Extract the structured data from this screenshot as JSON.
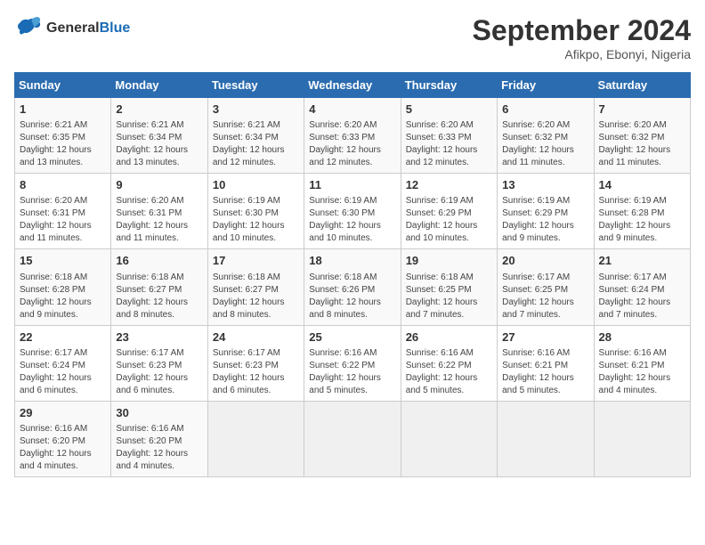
{
  "logo": {
    "line1": "General",
    "line2": "Blue"
  },
  "title": "September 2024",
  "location": "Afikpo, Ebonyi, Nigeria",
  "weekdays": [
    "Sunday",
    "Monday",
    "Tuesday",
    "Wednesday",
    "Thursday",
    "Friday",
    "Saturday"
  ],
  "days": [
    {
      "num": "",
      "info": ""
    },
    {
      "num": "",
      "info": ""
    },
    {
      "num": "",
      "info": ""
    },
    {
      "num": "",
      "info": ""
    },
    {
      "num": "",
      "info": ""
    },
    {
      "num": "",
      "info": ""
    },
    {
      "num": "1",
      "info": "Sunrise: 6:21 AM\nSunset: 6:35 PM\nDaylight: 12 hours\nand 13 minutes."
    },
    {
      "num": "2",
      "info": "Sunrise: 6:21 AM\nSunset: 6:34 PM\nDaylight: 12 hours\nand 13 minutes."
    },
    {
      "num": "3",
      "info": "Sunrise: 6:21 AM\nSunset: 6:34 PM\nDaylight: 12 hours\nand 12 minutes."
    },
    {
      "num": "4",
      "info": "Sunrise: 6:20 AM\nSunset: 6:33 PM\nDaylight: 12 hours\nand 12 minutes."
    },
    {
      "num": "5",
      "info": "Sunrise: 6:20 AM\nSunset: 6:33 PM\nDaylight: 12 hours\nand 12 minutes."
    },
    {
      "num": "6",
      "info": "Sunrise: 6:20 AM\nSunset: 6:32 PM\nDaylight: 12 hours\nand 11 minutes."
    },
    {
      "num": "7",
      "info": "Sunrise: 6:20 AM\nSunset: 6:32 PM\nDaylight: 12 hours\nand 11 minutes."
    },
    {
      "num": "8",
      "info": "Sunrise: 6:20 AM\nSunset: 6:31 PM\nDaylight: 12 hours\nand 11 minutes."
    },
    {
      "num": "9",
      "info": "Sunrise: 6:20 AM\nSunset: 6:31 PM\nDaylight: 12 hours\nand 11 minutes."
    },
    {
      "num": "10",
      "info": "Sunrise: 6:19 AM\nSunset: 6:30 PM\nDaylight: 12 hours\nand 10 minutes."
    },
    {
      "num": "11",
      "info": "Sunrise: 6:19 AM\nSunset: 6:30 PM\nDaylight: 12 hours\nand 10 minutes."
    },
    {
      "num": "12",
      "info": "Sunrise: 6:19 AM\nSunset: 6:29 PM\nDaylight: 12 hours\nand 10 minutes."
    },
    {
      "num": "13",
      "info": "Sunrise: 6:19 AM\nSunset: 6:29 PM\nDaylight: 12 hours\nand 9 minutes."
    },
    {
      "num": "14",
      "info": "Sunrise: 6:19 AM\nSunset: 6:28 PM\nDaylight: 12 hours\nand 9 minutes."
    },
    {
      "num": "15",
      "info": "Sunrise: 6:18 AM\nSunset: 6:28 PM\nDaylight: 12 hours\nand 9 minutes."
    },
    {
      "num": "16",
      "info": "Sunrise: 6:18 AM\nSunset: 6:27 PM\nDaylight: 12 hours\nand 8 minutes."
    },
    {
      "num": "17",
      "info": "Sunrise: 6:18 AM\nSunset: 6:27 PM\nDaylight: 12 hours\nand 8 minutes."
    },
    {
      "num": "18",
      "info": "Sunrise: 6:18 AM\nSunset: 6:26 PM\nDaylight: 12 hours\nand 8 minutes."
    },
    {
      "num": "19",
      "info": "Sunrise: 6:18 AM\nSunset: 6:25 PM\nDaylight: 12 hours\nand 7 minutes."
    },
    {
      "num": "20",
      "info": "Sunrise: 6:17 AM\nSunset: 6:25 PM\nDaylight: 12 hours\nand 7 minutes."
    },
    {
      "num": "21",
      "info": "Sunrise: 6:17 AM\nSunset: 6:24 PM\nDaylight: 12 hours\nand 7 minutes."
    },
    {
      "num": "22",
      "info": "Sunrise: 6:17 AM\nSunset: 6:24 PM\nDaylight: 12 hours\nand 6 minutes."
    },
    {
      "num": "23",
      "info": "Sunrise: 6:17 AM\nSunset: 6:23 PM\nDaylight: 12 hours\nand 6 minutes."
    },
    {
      "num": "24",
      "info": "Sunrise: 6:17 AM\nSunset: 6:23 PM\nDaylight: 12 hours\nand 6 minutes."
    },
    {
      "num": "25",
      "info": "Sunrise: 6:16 AM\nSunset: 6:22 PM\nDaylight: 12 hours\nand 5 minutes."
    },
    {
      "num": "26",
      "info": "Sunrise: 6:16 AM\nSunset: 6:22 PM\nDaylight: 12 hours\nand 5 minutes."
    },
    {
      "num": "27",
      "info": "Sunrise: 6:16 AM\nSunset: 6:21 PM\nDaylight: 12 hours\nand 5 minutes."
    },
    {
      "num": "28",
      "info": "Sunrise: 6:16 AM\nSunset: 6:21 PM\nDaylight: 12 hours\nand 4 minutes."
    },
    {
      "num": "29",
      "info": "Sunrise: 6:16 AM\nSunset: 6:20 PM\nDaylight: 12 hours\nand 4 minutes."
    },
    {
      "num": "30",
      "info": "Sunrise: 6:16 AM\nSunset: 6:20 PM\nDaylight: 12 hours\nand 4 minutes."
    },
    {
      "num": "",
      "info": ""
    },
    {
      "num": "",
      "info": ""
    },
    {
      "num": "",
      "info": ""
    },
    {
      "num": "",
      "info": ""
    },
    {
      "num": "",
      "info": ""
    }
  ]
}
